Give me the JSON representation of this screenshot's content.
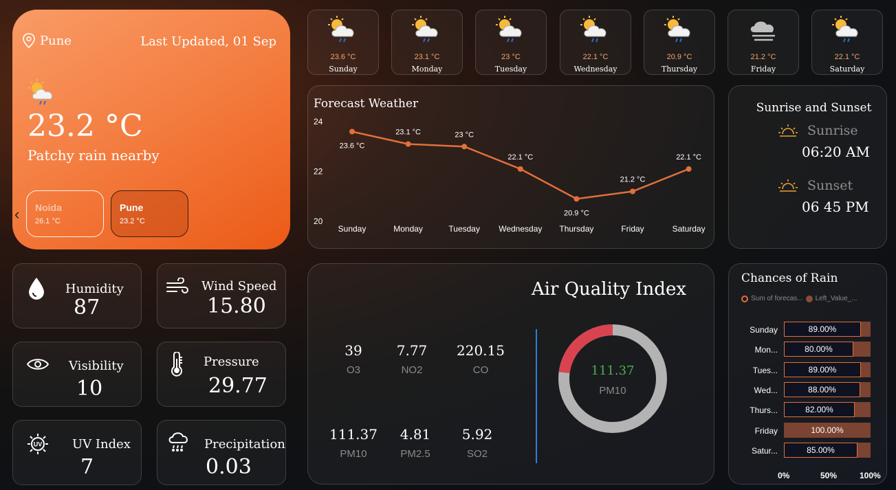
{
  "hero": {
    "location": "Pune",
    "last_updated": "Last Updated, 01 Sep",
    "temperature": "23.2 °C",
    "condition": "Patchy rain nearby",
    "prev_icon": "chevron-left-icon",
    "cities": [
      {
        "name": "Noida",
        "temp": "26.1 °C"
      },
      {
        "name": "Pune",
        "temp": "23.2 °C"
      }
    ]
  },
  "days": [
    {
      "day": "Sunday",
      "temp": "23.6 °C",
      "icon": "partly-cloudy-rain-icon"
    },
    {
      "day": "Monday",
      "temp": "23.1 °C",
      "icon": "partly-cloudy-rain-icon"
    },
    {
      "day": "Tuesday",
      "temp": "23 °C",
      "icon": "partly-cloudy-rain-icon"
    },
    {
      "day": "Wednesday",
      "temp": "22.1 °C",
      "icon": "partly-cloudy-rain-icon"
    },
    {
      "day": "Thursday",
      "temp": "20.9 °C",
      "icon": "partly-cloudy-rain-icon"
    },
    {
      "day": "Friday",
      "temp": "21.2 °C",
      "icon": "fog-icon"
    },
    {
      "day": "Saturday",
      "temp": "22.1 °C",
      "icon": "partly-cloudy-rain-icon"
    }
  ],
  "forecast": {
    "title": "Forecast Weather"
  },
  "chart_data": [
    {
      "type": "line",
      "title": "Forecast Weather",
      "categories": [
        "Sunday",
        "Monday",
        "Tuesday",
        "Wednesday",
        "Thursday",
        "Friday",
        "Saturday"
      ],
      "values": [
        23.6,
        23.1,
        23,
        22.1,
        20.9,
        21.2,
        22.1
      ],
      "data_labels": [
        "23.6 °C",
        "23.1 °C",
        "23 °C",
        "22.1 °C",
        "20.9 °C",
        "21.2 °C",
        "22.1 °C"
      ],
      "y_ticks": [
        "20",
        "22",
        "24"
      ],
      "ylim": [
        20,
        24
      ],
      "color": "#e2703a"
    },
    {
      "type": "bar",
      "title": "Chances of Rain",
      "legend": [
        "Sum of forecas...",
        "Left_Value_..."
      ],
      "categories": [
        "Sunday",
        "Mon...",
        "Tues...",
        "Wed...",
        "Thurs...",
        "Friday",
        "Satur..."
      ],
      "values": [
        89,
        80,
        89,
        88,
        82,
        100,
        85
      ],
      "value_labels": [
        "89.00%",
        "80.00%",
        "89.00%",
        "88.00%",
        "82.00%",
        "100.00%",
        "85.00%"
      ],
      "x_ticks": [
        "0%",
        "50%",
        "100%"
      ],
      "xlim": [
        0,
        100
      ]
    }
  ],
  "sun": {
    "title": "Sunrise and Sunset",
    "sunrise_label": "Sunrise",
    "sunrise_time": "06:20 AM",
    "sunset_label": "Sunset",
    "sunset_time": "06 45 PM"
  },
  "stats": {
    "humidity": {
      "label": "Humidity",
      "value": "87"
    },
    "wind": {
      "label": "Wind Speed",
      "value": "15.80"
    },
    "visibility": {
      "label": "Visibility",
      "value": "10"
    },
    "pressure": {
      "label": "Pressure",
      "value": "29.77"
    },
    "uv": {
      "label": "UV Index",
      "value": "7"
    },
    "precip": {
      "label": "Precipitation",
      "value": "0.03"
    }
  },
  "aqi": {
    "title": "Air Quality Index",
    "pollutants": [
      {
        "value": "39",
        "name": "O3"
      },
      {
        "value": "7.77",
        "name": "NO2"
      },
      {
        "value": "220.15",
        "name": "CO"
      },
      {
        "value": "111.37",
        "name": "PM10"
      },
      {
        "value": "4.81",
        "name": "PM2.5"
      },
      {
        "value": "5.92",
        "name": "SO2"
      }
    ],
    "gauge_value": "111.37",
    "gauge_label": "PM10",
    "gauge_fraction": 0.23
  },
  "colors": {
    "accent": "#e2703a",
    "rain_bar": "#7b4332",
    "gauge_red": "#d9434f",
    "gauge_grey": "#b3b3b3",
    "gauge_value": "#4caf50"
  }
}
